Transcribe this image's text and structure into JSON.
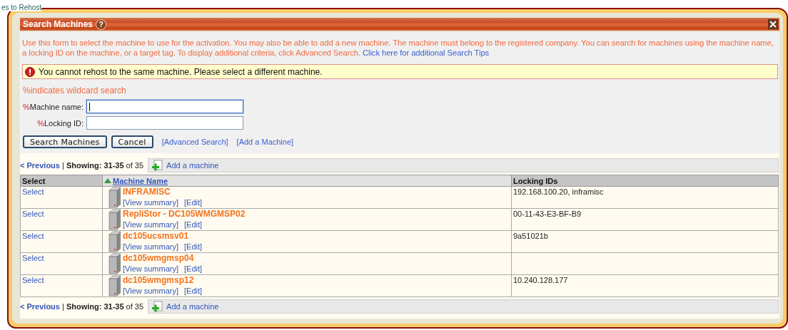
{
  "background_page": {
    "title_fragment": "es to Rehost"
  },
  "dialog": {
    "title": "Search Machines",
    "help": "?",
    "intro": "Use this form to select the machine to use for the activation. You may also be able to add a new machine. The machine must belong to the registered company. You can search for machines using the machine name, a locking ID on the machine, or a target tag. To display additional criteria, click Advanced Search.",
    "intro_link": "Click here for additional Search Tips",
    "message": {
      "kind": "error",
      "text": "You cannot rehost to the same machine. Please select a different machine."
    },
    "wildcard_note": "%indicates wildcard search",
    "fields": [
      {
        "prefix": "%",
        "label": "Machine name:",
        "focused": true
      },
      {
        "prefix": "%",
        "label": "Locking ID:",
        "focused": false
      }
    ],
    "buttons": [
      "Search Machines",
      "Cancel"
    ],
    "links": [
      "[Advanced Search]",
      "[Add a Machine]"
    ]
  },
  "results": {
    "pager_top": {
      "previous": "< Previous",
      "showing": "| **Showing: 31-35** of 35",
      "add": "Add a machine"
    },
    "columns": [
      {
        "label": "Select",
        "sorted": false
      },
      {
        "label": "Machine Name",
        "sorted": true
      },
      {
        "label": "Locking IDs",
        "sorted": false
      }
    ],
    "rows": [
      {
        "select": "Select",
        "name": "INFRAMISC",
        "view": "[View summary]",
        "edit": "[Edit]",
        "locking_ids": "192.168.100.20, inframisc"
      },
      {
        "select": "Select",
        "name": "RepliStor - DC105WMGMSP02",
        "view": "[View summary]",
        "edit": "[Edit]",
        "locking_ids": "00-11-43-E3-BF-B9"
      },
      {
        "select": "Select",
        "name": "dc105ucsmsv01",
        "view": "[View summary]",
        "edit": "[Edit]",
        "locking_ids": "9a51021b"
      },
      {
        "select": "Select",
        "name": "dc105wmgmsp04",
        "view": "[View summary]",
        "edit": "[Edit]"
      },
      {
        "select": "Select",
        "name": "dc105wmgmsp12",
        "view": "[View summary]",
        "edit": "[Edit]",
        "locking_ids": "10.240.128.177"
      }
    ],
    "pager_bottom": {
      "previous": "< Previous",
      "showing": "| **Showing: 31-35** of 35",
      "add": "Add a machine"
    }
  }
}
